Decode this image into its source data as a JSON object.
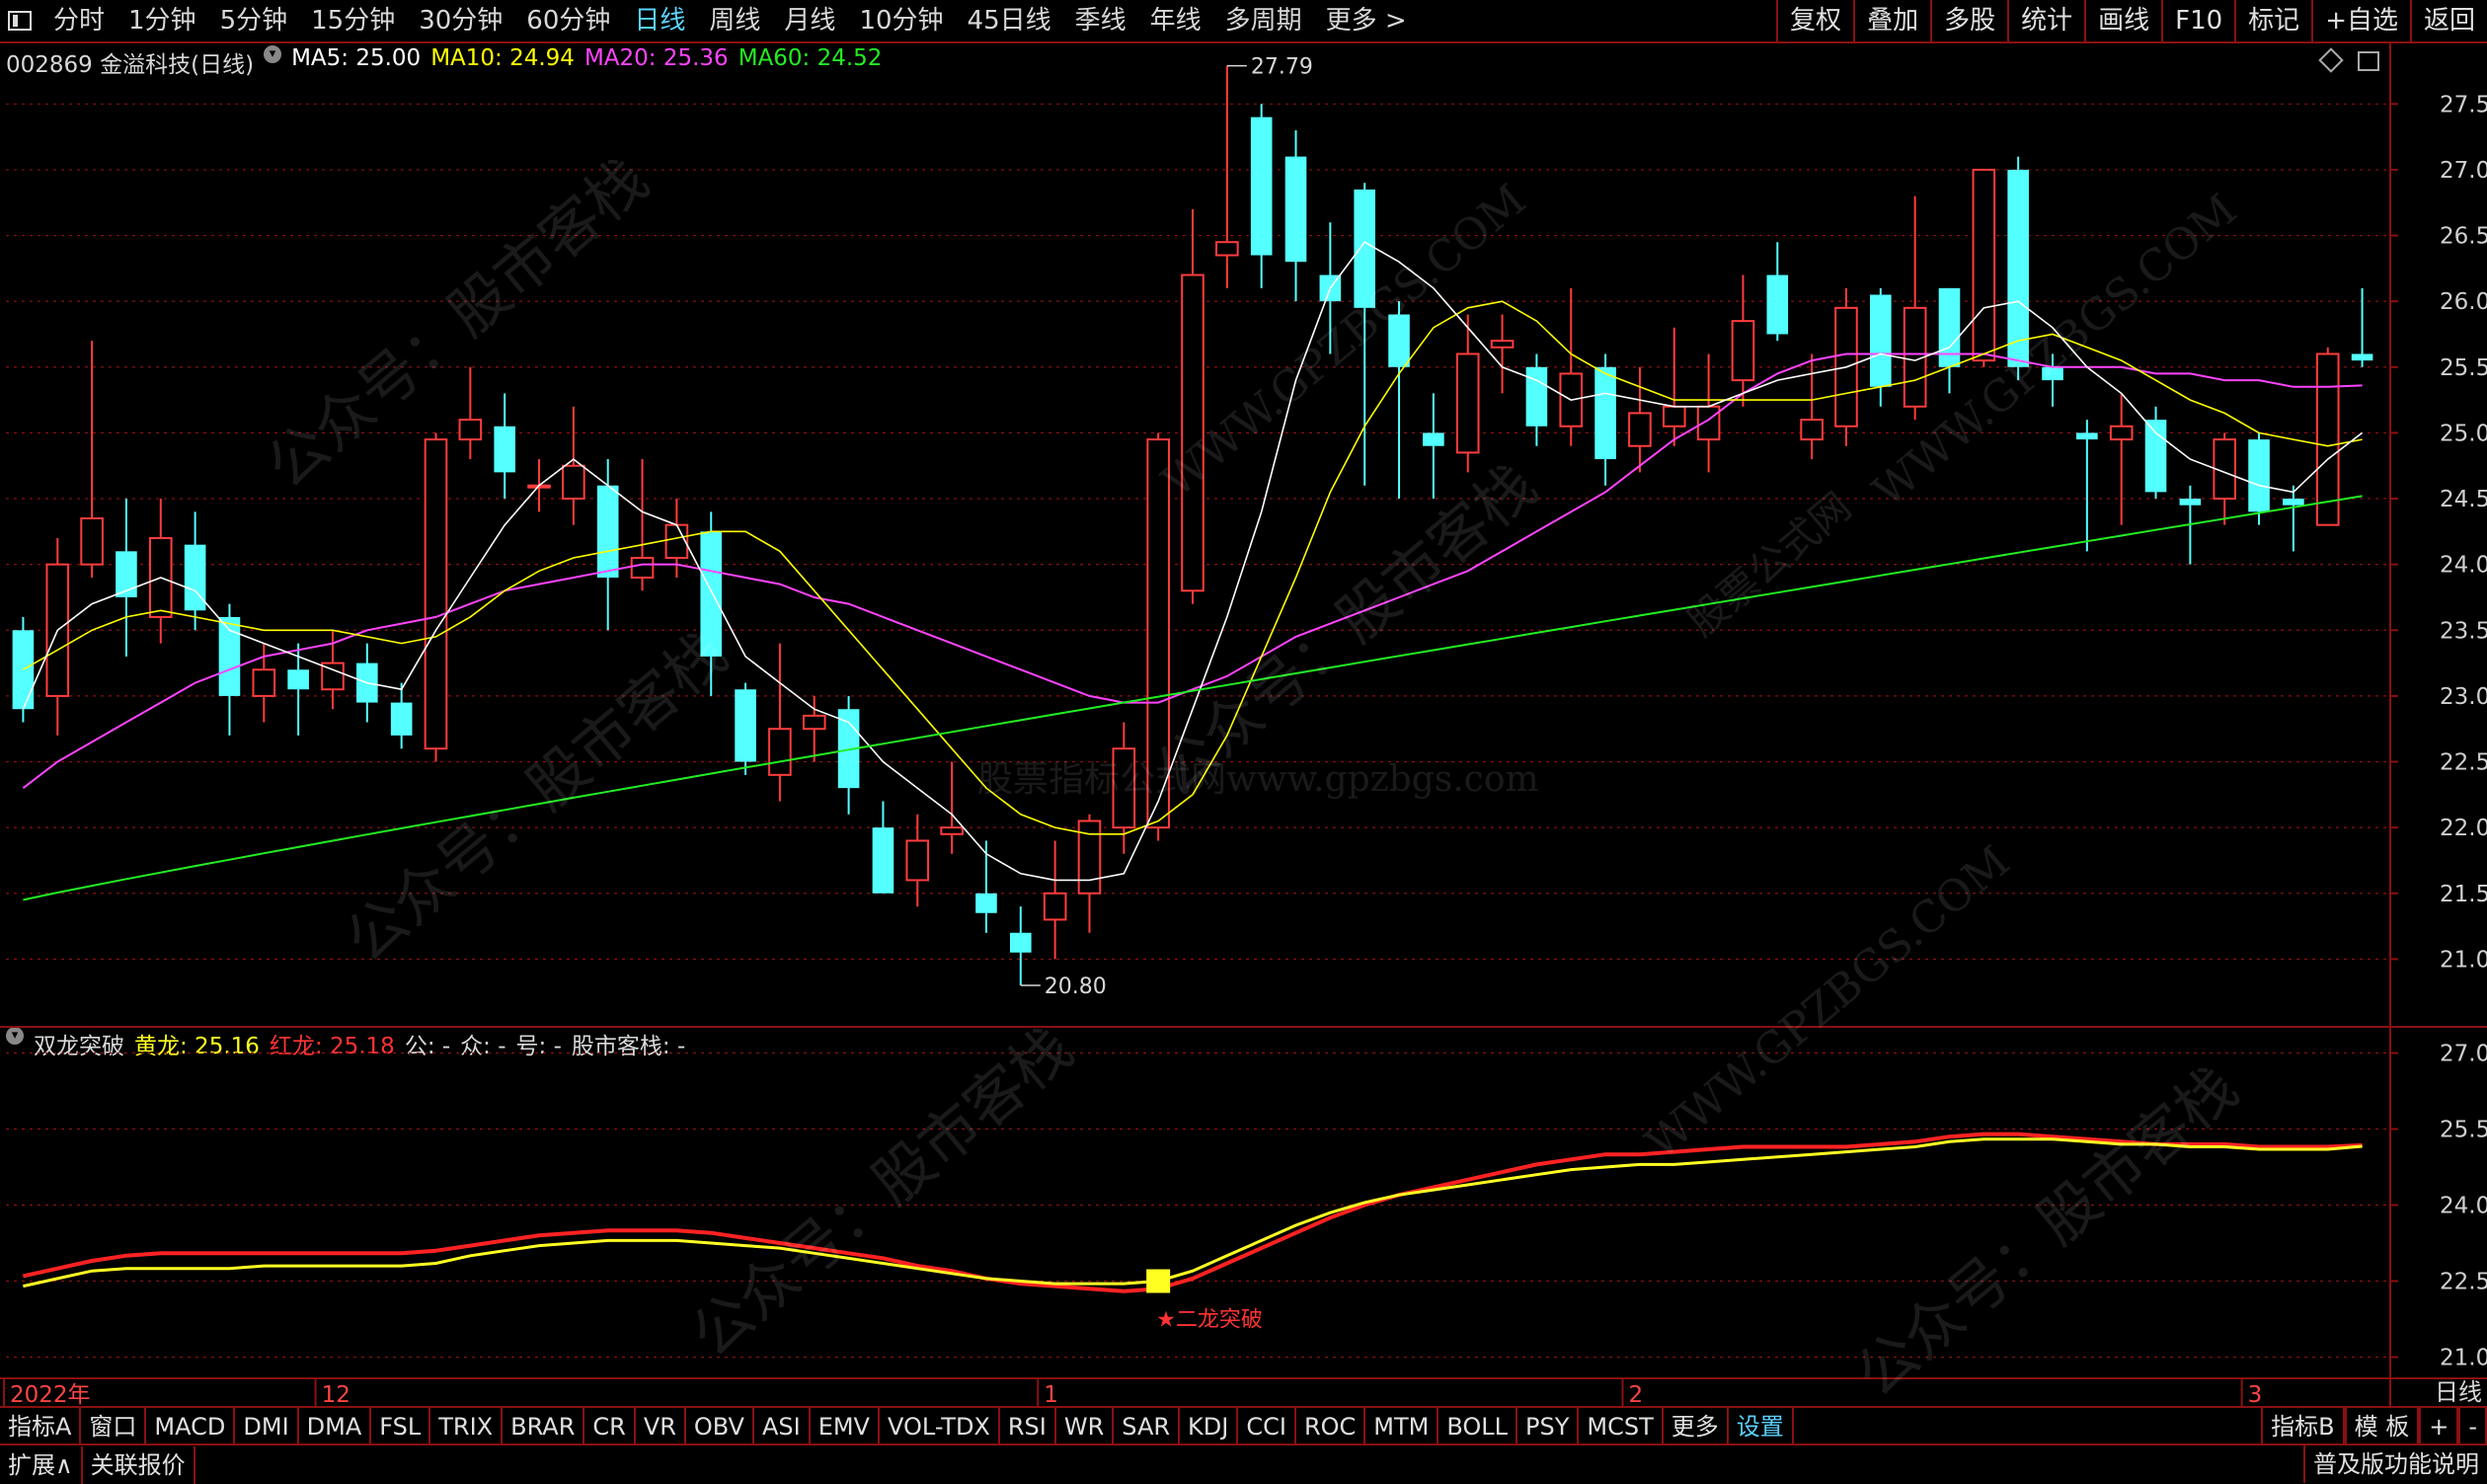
{
  "top_menu": {
    "periods": [
      "分时",
      "1分钟",
      "5分钟",
      "15分钟",
      "30分钟",
      "60分钟",
      "日线",
      "周线",
      "月线",
      "10分钟",
      "45日线",
      "季线",
      "年线",
      "多周期",
      "更多 >"
    ],
    "active": "日线",
    "right_buttons": [
      "复权",
      "叠加",
      "多股",
      "统计",
      "画线",
      "F10",
      "标记",
      "+自选",
      "返回"
    ]
  },
  "stock_info": {
    "code_name": "002869 金溢科技(日线)",
    "ma5": "MA5: 25.00",
    "ma10": "MA10: 24.94",
    "ma20": "MA20: 25.36",
    "ma60": "MA60: 24.52"
  },
  "indicator_info": {
    "name": "双龙突破",
    "huanglong": "黄龙: 25.16",
    "honglong": "红龙: 25.18",
    "extra1": "公: -",
    "extra2": "众: -",
    "extra3": "号: -",
    "extra4": "股市客栈: -"
  },
  "annotations": {
    "high_label": "27.79",
    "low_label": "20.80",
    "signal_label": "★二龙突破"
  },
  "x_axis": {
    "labels": [
      "2022年",
      "12",
      "1",
      "2",
      "3"
    ],
    "period_label": "日线"
  },
  "bottom_tabs": [
    "指标A",
    "窗口",
    "MACD",
    "DMI",
    "DMA",
    "FSL",
    "TRIX",
    "BRAR",
    "CR",
    "VR",
    "OBV",
    "ASI",
    "EMV",
    "VOL-TDX",
    "RSI",
    "WR",
    "SAR",
    "KDJ",
    "CCI",
    "ROC",
    "MTM",
    "BOLL",
    "PSY",
    "MCST",
    "更多",
    "设置"
  ],
  "bottom_right_tabs": [
    "指标B",
    "模 板",
    "+",
    "-"
  ],
  "bottom_bar2": {
    "left": [
      "扩展∧",
      "关联报价"
    ],
    "right": "普及版功能说明"
  },
  "watermarks": [
    "公众号：股市客栈",
    "WWW.GPZBGS.COM",
    "股票公式网",
    "股票指标公式网www.gpzbgs.com"
  ],
  "colors": {
    "up": "#ff3c3c",
    "down": "#54ffff",
    "ma5": "#ffffff",
    "ma10": "#ffff00",
    "ma20": "#ff44ff",
    "ma60": "#22ee22",
    "yellow_dragon": "#ffff22",
    "red_dragon": "#ff2222",
    "grid": "#8a1010"
  },
  "chart_data": [
    {
      "type": "candlestick",
      "title": "002869 金溢科技(日线)",
      "ylim": [
        20.5,
        27.9
      ],
      "y_ticks": [
        "21.00",
        "21.50",
        "22.00",
        "22.50",
        "23.00",
        "23.50",
        "24.00",
        "24.50",
        "25.00",
        "25.50",
        "26.00",
        "26.50",
        "27.00",
        "27.50"
      ],
      "candles": [
        [
          23.5,
          22.9,
          23.6,
          22.8
        ],
        [
          23.0,
          24.0,
          24.2,
          22.7
        ],
        [
          24.0,
          24.35,
          25.7,
          23.9
        ],
        [
          24.1,
          23.75,
          24.5,
          23.3
        ],
        [
          23.6,
          24.2,
          24.5,
          23.4
        ],
        [
          24.15,
          23.65,
          24.4,
          23.5
        ],
        [
          23.6,
          23.0,
          23.7,
          22.7
        ],
        [
          23.0,
          23.2,
          23.4,
          22.8
        ],
        [
          23.2,
          23.05,
          23.4,
          22.7
        ],
        [
          23.05,
          23.25,
          23.5,
          22.9
        ],
        [
          23.25,
          22.95,
          23.4,
          22.8
        ],
        [
          22.95,
          22.7,
          23.1,
          22.6
        ],
        [
          22.6,
          24.95,
          25.0,
          22.5
        ],
        [
          24.95,
          25.1,
          25.5,
          24.8
        ],
        [
          25.05,
          24.7,
          25.3,
          24.5
        ],
        [
          24.6,
          24.6,
          24.8,
          24.4
        ],
        [
          24.5,
          24.75,
          25.2,
          24.3
        ],
        [
          24.6,
          23.9,
          24.8,
          23.5
        ],
        [
          23.9,
          24.05,
          24.8,
          23.8
        ],
        [
          24.05,
          24.3,
          24.5,
          23.9
        ],
        [
          24.25,
          23.3,
          24.4,
          23.0
        ],
        [
          23.05,
          22.5,
          23.1,
          22.4
        ],
        [
          22.4,
          22.75,
          23.4,
          22.2
        ],
        [
          22.75,
          22.85,
          23.0,
          22.5
        ],
        [
          22.9,
          22.3,
          23.0,
          22.1
        ],
        [
          22.0,
          21.5,
          22.2,
          21.5
        ],
        [
          21.6,
          21.9,
          22.1,
          21.4
        ],
        [
          21.95,
          22.0,
          22.5,
          21.8
        ],
        [
          21.5,
          21.35,
          21.9,
          21.2
        ],
        [
          21.2,
          21.05,
          21.4,
          20.8
        ],
        [
          21.3,
          21.5,
          21.9,
          21.0
        ],
        [
          21.5,
          22.05,
          22.1,
          21.2
        ],
        [
          22.0,
          22.6,
          22.8,
          21.8
        ],
        [
          22.0,
          24.95,
          25.0,
          21.9
        ],
        [
          23.8,
          26.2,
          26.7,
          23.7
        ],
        [
          26.35,
          26.45,
          27.79,
          26.1
        ],
        [
          27.4,
          26.35,
          27.5,
          26.1
        ],
        [
          27.1,
          26.3,
          27.3,
          26.0
        ],
        [
          26.2,
          26.0,
          26.6,
          25.6
        ],
        [
          26.85,
          25.95,
          26.9,
          24.6
        ],
        [
          25.9,
          25.5,
          26.0,
          24.5
        ],
        [
          25.0,
          24.9,
          25.3,
          24.5
        ],
        [
          24.85,
          25.6,
          25.9,
          24.7
        ],
        [
          25.65,
          25.7,
          25.9,
          25.3
        ],
        [
          25.5,
          25.05,
          25.6,
          24.9
        ],
        [
          25.05,
          25.45,
          26.1,
          24.9
        ],
        [
          25.5,
          24.8,
          25.6,
          24.6
        ],
        [
          24.9,
          25.15,
          25.5,
          24.7
        ],
        [
          25.05,
          25.2,
          25.8,
          24.9
        ],
        [
          24.95,
          25.2,
          25.6,
          24.7
        ],
        [
          25.4,
          25.85,
          26.2,
          25.2
        ],
        [
          26.2,
          25.75,
          26.45,
          25.7
        ],
        [
          24.95,
          25.1,
          25.6,
          24.8
        ],
        [
          25.05,
          25.95,
          26.1,
          24.9
        ],
        [
          26.05,
          25.35,
          26.1,
          25.2
        ],
        [
          25.2,
          25.95,
          26.8,
          25.1
        ],
        [
          26.1,
          25.5,
          26.1,
          25.3
        ],
        [
          25.55,
          27.0,
          27.0,
          25.5
        ],
        [
          27.0,
          25.5,
          27.1,
          25.4
        ],
        [
          25.5,
          25.4,
          25.6,
          25.2
        ],
        [
          25.0,
          24.95,
          25.1,
          24.1
        ],
        [
          24.95,
          25.05,
          25.3,
          24.3
        ],
        [
          25.1,
          24.55,
          25.2,
          24.5
        ],
        [
          24.5,
          24.45,
          24.6,
          24.0
        ],
        [
          24.5,
          24.95,
          25.0,
          24.3
        ],
        [
          24.95,
          24.4,
          25.0,
          24.3
        ],
        [
          24.5,
          24.45,
          24.6,
          24.1
        ],
        [
          24.3,
          25.6,
          25.65,
          24.3
        ],
        [
          25.6,
          25.55,
          26.1,
          25.5
        ]
      ],
      "ma5": [
        22.9,
        23.5,
        23.7,
        23.8,
        23.9,
        23.8,
        23.5,
        23.4,
        23.3,
        23.2,
        23.1,
        23.05,
        23.5,
        23.9,
        24.3,
        24.6,
        24.8,
        24.6,
        24.4,
        24.3,
        23.8,
        23.3,
        23.1,
        22.9,
        22.8,
        22.5,
        22.3,
        22.1,
        21.8,
        21.65,
        21.6,
        21.6,
        21.65,
        22.2,
        22.9,
        23.6,
        24.4,
        25.4,
        26.1,
        26.45,
        26.3,
        26.1,
        25.8,
        25.5,
        25.4,
        25.25,
        25.3,
        25.25,
        25.2,
        25.2,
        25.3,
        25.4,
        25.45,
        25.5,
        25.6,
        25.55,
        25.65,
        25.95,
        26.0,
        25.8,
        25.5,
        25.3,
        25.0,
        24.8,
        24.7,
        24.6,
        24.55,
        24.8,
        25.0
      ],
      "ma10": [
        23.2,
        23.35,
        23.5,
        23.6,
        23.65,
        23.6,
        23.55,
        23.5,
        23.5,
        23.5,
        23.45,
        23.4,
        23.45,
        23.6,
        23.8,
        23.95,
        24.05,
        24.1,
        24.15,
        24.2,
        24.25,
        24.25,
        24.1,
        23.8,
        23.5,
        23.2,
        22.9,
        22.6,
        22.3,
        22.1,
        22.0,
        21.95,
        21.95,
        22.05,
        22.25,
        22.7,
        23.3,
        23.9,
        24.55,
        25.05,
        25.45,
        25.8,
        25.95,
        26.0,
        25.85,
        25.6,
        25.45,
        25.35,
        25.25,
        25.25,
        25.25,
        25.25,
        25.25,
        25.3,
        25.35,
        25.4,
        25.5,
        25.6,
        25.7,
        25.75,
        25.65,
        25.55,
        25.4,
        25.25,
        25.15,
        25.0,
        24.95,
        24.9,
        24.95
      ],
      "ma20": [
        22.3,
        22.5,
        22.65,
        22.8,
        22.95,
        23.1,
        23.2,
        23.3,
        23.35,
        23.4,
        23.5,
        23.55,
        23.6,
        23.7,
        23.8,
        23.85,
        23.9,
        23.95,
        24.0,
        24.0,
        23.95,
        23.9,
        23.85,
        23.75,
        23.7,
        23.6,
        23.5,
        23.4,
        23.3,
        23.2,
        23.1,
        23.0,
        22.95,
        22.95,
        23.05,
        23.15,
        23.3,
        23.45,
        23.55,
        23.65,
        23.75,
        23.85,
        23.95,
        24.1,
        24.25,
        24.4,
        24.55,
        24.75,
        24.95,
        25.1,
        25.3,
        25.45,
        25.55,
        25.6,
        25.6,
        25.6,
        25.6,
        25.6,
        25.55,
        25.5,
        25.5,
        25.5,
        25.45,
        25.45,
        25.4,
        25.4,
        25.35,
        25.35,
        25.36
      ]
    },
    {
      "type": "line",
      "title": "双龙突破",
      "ylim": [
        20.6,
        27.4
      ],
      "y_ticks": [
        "21.00",
        "22.50",
        "24.00",
        "25.50",
        "27.00"
      ],
      "series": [
        {
          "name": "黄龙",
          "values": [
            22.4,
            22.55,
            22.7,
            22.75,
            22.75,
            22.75,
            22.75,
            22.8,
            22.8,
            22.8,
            22.8,
            22.8,
            22.85,
            23.0,
            23.1,
            23.2,
            23.25,
            23.3,
            23.3,
            23.3,
            23.25,
            23.2,
            23.15,
            23.05,
            22.95,
            22.85,
            22.75,
            22.65,
            22.55,
            22.5,
            22.45,
            22.45,
            22.45,
            22.5,
            22.7,
            23.0,
            23.3,
            23.6,
            23.85,
            24.05,
            24.2,
            24.3,
            24.4,
            24.5,
            24.6,
            24.7,
            24.75,
            24.8,
            24.8,
            24.85,
            24.9,
            24.95,
            25.0,
            25.05,
            25.1,
            25.15,
            25.25,
            25.3,
            25.3,
            25.3,
            25.25,
            25.2,
            25.2,
            25.15,
            25.15,
            25.1,
            25.1,
            25.1,
            25.16
          ]
        },
        {
          "name": "红龙",
          "values": [
            22.6,
            22.75,
            22.9,
            23.0,
            23.05,
            23.05,
            23.05,
            23.05,
            23.05,
            23.05,
            23.05,
            23.05,
            23.1,
            23.2,
            23.3,
            23.4,
            23.45,
            23.5,
            23.5,
            23.5,
            23.45,
            23.35,
            23.25,
            23.15,
            23.05,
            22.95,
            22.8,
            22.7,
            22.55,
            22.45,
            22.4,
            22.35,
            22.3,
            22.35,
            22.55,
            22.85,
            23.15,
            23.45,
            23.75,
            24.0,
            24.2,
            24.35,
            24.5,
            24.65,
            24.8,
            24.9,
            25.0,
            25.0,
            25.05,
            25.1,
            25.15,
            25.15,
            25.15,
            25.15,
            25.2,
            25.25,
            25.35,
            25.4,
            25.4,
            25.35,
            25.3,
            25.25,
            25.2,
            25.2,
            25.2,
            25.15,
            25.15,
            25.15,
            25.18
          ]
        }
      ],
      "signal_index": 33
    }
  ]
}
